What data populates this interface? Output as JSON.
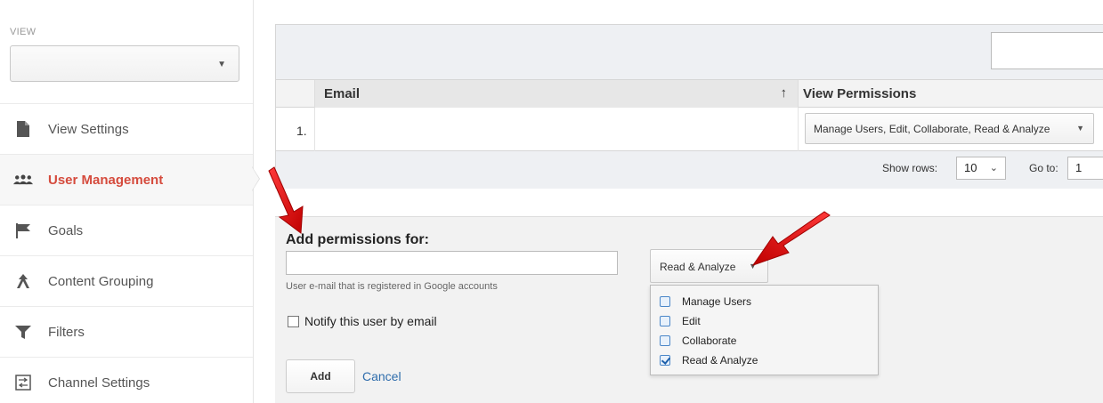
{
  "sidebar": {
    "view_label": "VIEW",
    "view_select_value": "",
    "items": [
      {
        "label": "View Settings",
        "icon": "document-icon"
      },
      {
        "label": "User Management",
        "icon": "users-icon"
      },
      {
        "label": "Goals",
        "icon": "flag-icon"
      },
      {
        "label": "Content Grouping",
        "icon": "grouping-icon"
      },
      {
        "label": "Filters",
        "icon": "filter-icon"
      },
      {
        "label": "Channel Settings",
        "icon": "channel-settings-icon"
      }
    ],
    "active_item": "User Management",
    "active_color": "#d54b3d"
  },
  "table": {
    "search_value": "",
    "columns": [
      "Email",
      "View Permissions"
    ],
    "sort_indicator": "↑",
    "rows": [
      {
        "num": "1.",
        "email": "",
        "permissions": "Manage Users, Edit, Collaborate, Read & Analyze"
      }
    ],
    "footer": {
      "show_rows_label": "Show rows:",
      "show_rows_value": "10",
      "goto_label": "Go to:",
      "goto_value": "1"
    }
  },
  "add_permissions": {
    "title": "Add permissions for:",
    "email_value": "",
    "email_help": "User e-mail that is registered in Google accounts",
    "notify_label": "Notify this user by email",
    "notify_checked": false,
    "permission_select": "Read & Analyze",
    "options": [
      {
        "label": "Manage Users",
        "checked": false
      },
      {
        "label": "Edit",
        "checked": false
      },
      {
        "label": "Collaborate",
        "checked": false
      },
      {
        "label": "Read & Analyze",
        "checked": true
      }
    ],
    "add_label": "Add",
    "cancel_label": "Cancel"
  },
  "colors": {
    "arrow": "#e01f1f",
    "link": "#2f6dac"
  }
}
